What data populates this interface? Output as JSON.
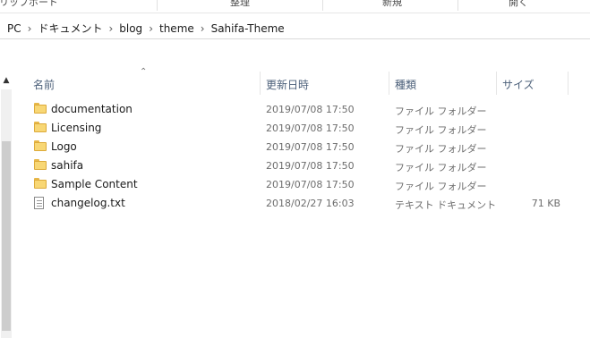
{
  "ribbon": {
    "items": [
      "クリップボード",
      "整理",
      "新規",
      "開く"
    ]
  },
  "breadcrumb": [
    "PC",
    "ドキュメント",
    "blog",
    "theme",
    "Sahifa-Theme"
  ],
  "columns": {
    "name": "名前",
    "date": "更新日時",
    "type": "種類",
    "size": "サイズ"
  },
  "files": [
    {
      "name": "documentation",
      "date": "2019/07/08 17:50",
      "type": "ファイル フォルダー",
      "size": "",
      "icon": "folder-icon"
    },
    {
      "name": "Licensing",
      "date": "2019/07/08 17:50",
      "type": "ファイル フォルダー",
      "size": "",
      "icon": "folder-icon"
    },
    {
      "name": "Logo",
      "date": "2019/07/08 17:50",
      "type": "ファイル フォルダー",
      "size": "",
      "icon": "folder-icon"
    },
    {
      "name": "sahifa",
      "date": "2019/07/08 17:50",
      "type": "ファイル フォルダー",
      "size": "",
      "icon": "folder-icon"
    },
    {
      "name": "Sample Content",
      "date": "2019/07/08 17:50",
      "type": "ファイル フォルダー",
      "size": "",
      "icon": "folder-icon"
    },
    {
      "name": "changelog.txt",
      "date": "2018/02/27 16:03",
      "type": "テキスト ドキュメント",
      "size": "71 KB",
      "icon": "text-file-icon"
    }
  ]
}
